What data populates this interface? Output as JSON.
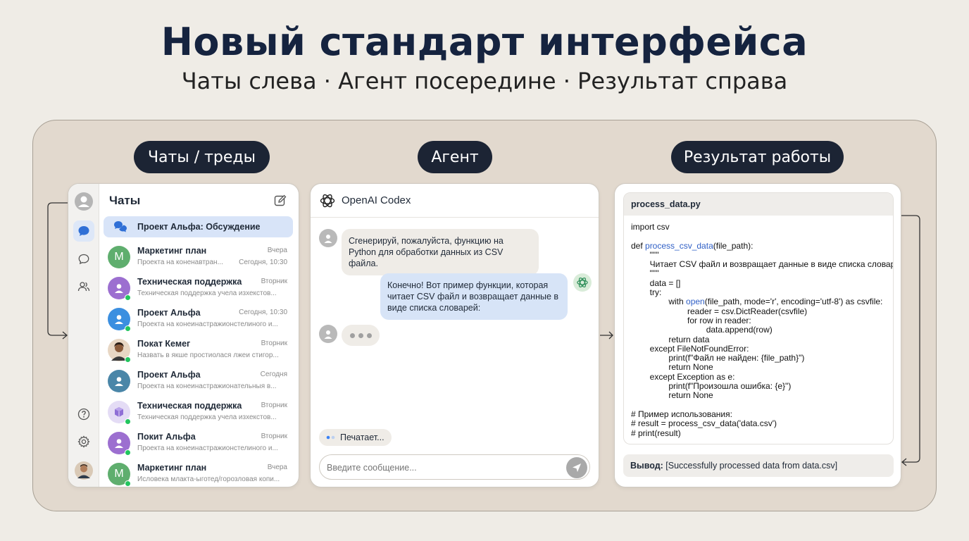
{
  "hero": {
    "title": "Новый стандарт интерфейса",
    "subtitle": "Чаты слева · Агент посередине · Результат справа"
  },
  "sections": {
    "chats_label": "Чаты / треды",
    "agent_label": "Агент",
    "result_label": "Результат работы"
  },
  "chats": {
    "title": "Чаты",
    "selected": {
      "label": "Проект Альфа: Обсуждение"
    },
    "items": [
      {
        "name": "Маркетинг план",
        "time": "Вчера",
        "preview": "Проекта на коненавтран...",
        "time2": "Сегодня, 10:30",
        "avatar": "M",
        "color": "#5fae6e"
      },
      {
        "name": "Техническая поддержка",
        "time": "Вторник",
        "preview": "Техническая поддержка учела изхекстов...",
        "avatar": "",
        "color": "#9c6fd0"
      },
      {
        "name": "Проект Альфа",
        "time": "Сегодня, 10:30",
        "preview": "Проекта на конеинастражионстелиного и...",
        "avatar": "",
        "color": "#3b8fe0"
      },
      {
        "name": "Покат Кемег",
        "time": "Вторник",
        "preview": "Назвать в якше простиолася лжеи стигор...",
        "avatar": "",
        "color": "#5a4638"
      },
      {
        "name": "Проект Альфа",
        "time": "Сегодня",
        "preview": "Проекта на конеинастражионательныя в...",
        "avatar": "",
        "color": "#4a86a8"
      },
      {
        "name": "Техническая поддержка",
        "time": "Вторник",
        "preview": "Техническая поддержка учела изхекстов...",
        "avatar": "",
        "color": "#c9b8ec"
      },
      {
        "name": "Покит Альфа",
        "time": "Вторник",
        "preview": "Проекта на конеинастражионстелиного и...",
        "avatar": "",
        "color": "#9c6fd0"
      },
      {
        "name": "Маркетинг план",
        "time": "Вчера",
        "preview": "Исловека млакта-ыготед/горозловая копи...",
        "avatar": "M",
        "color": "#5fae6e"
      }
    ]
  },
  "agent": {
    "title": "OpenAI Codex",
    "user_message": "Сгенерируй, пожалуйста, функцию на Python для обработки данных из CSV файла.",
    "bot_message": "Конечно! Вот пример функции, которая читает CSV файл и возвращает данные в виде списка словарей:",
    "status": "Печатает...",
    "input_placeholder": "Введите сообщение..."
  },
  "result": {
    "filename": "process_data.py",
    "code_lines": [
      "import csv",
      "",
      "def |process_csv_data|(file_path):",
      "        \"\"\"",
      "        Читает CSV файл и возвращает данные в виде списка словарей.",
      "        \"\"\"",
      "        data = []",
      "        try:",
      "                with |open|(file_path, mode='r', encoding='utf-8') as csvfile:",
      "                        reader = csv.DictReader(csvfile)",
      "                        for row in reader:",
      "                                data.append(row)",
      "                return data",
      "        except FileNotFoundError:",
      "                print(f\"Файл не найден: {file_path}\")",
      "                return None",
      "        except Exception as e:",
      "                print(f\"Произошла ошибка: {e}\")",
      "                return None",
      "",
      "# Пример использования:",
      "# result = process_csv_data('data.csv')",
      "# print(result)"
    ],
    "output_label": "Вывод:",
    "output_value": " [Successfully processed data from data.csv]"
  },
  "colors": {
    "navy": "#15233f",
    "pill": "#1c2434",
    "frame": "#e2d9ce",
    "selected": "#d8e4f8",
    "bot_bubble": "#d7e4f7",
    "online": "#22c55e",
    "code_fn": "#2f5fc6"
  }
}
